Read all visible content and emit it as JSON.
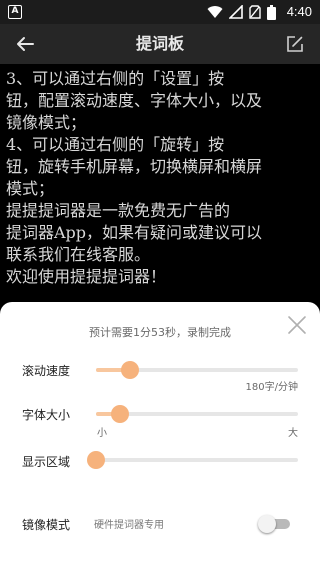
{
  "status_bar": {
    "app_badge": "A",
    "time": "4:40",
    "icons": [
      "wifi-icon",
      "signal-icon",
      "no-sim-icon",
      "battery-icon"
    ]
  },
  "toolbar": {
    "title": "提词板",
    "back_icon": "arrow-left-icon",
    "edit_icon": "edit-icon"
  },
  "prompt": {
    "lines": [
      "    3、可以通过右侧的「设置」按",
      "钮，配置滚动速度、字体大小，以及",
      "镜像模式；",
      "    4、可以通过右侧的「旋转」按",
      "钮，旋转手机屏幕，切换横屏和横屏",
      "模式；",
      "    提提提词器是一款免费无广告的",
      "提词器App，如果有疑问或建议可以",
      "联系我们在线客服。",
      "    欢迎使用提提提词器！"
    ]
  },
  "settings": {
    "estimate": "预计需要1分53秒，录制完成",
    "scroll_speed": {
      "label": "滚动速度",
      "value_text": "180字/分钟",
      "level": 0.17
    },
    "font_size": {
      "label": "字体大小",
      "min_label": "小",
      "max_label": "大",
      "level": 0.12
    },
    "display_area": {
      "label": "显示区域",
      "level": 0.0
    },
    "mirror": {
      "label": "镜像模式",
      "sub": "硬件提词器专用",
      "enabled": false
    }
  },
  "colors": {
    "accent": "#f6b27c",
    "accent_light": "#f8c79e",
    "toolbar_bg": "#262626",
    "status_bg": "#1c1c1c",
    "prompt_text": "#d8d8d8"
  }
}
